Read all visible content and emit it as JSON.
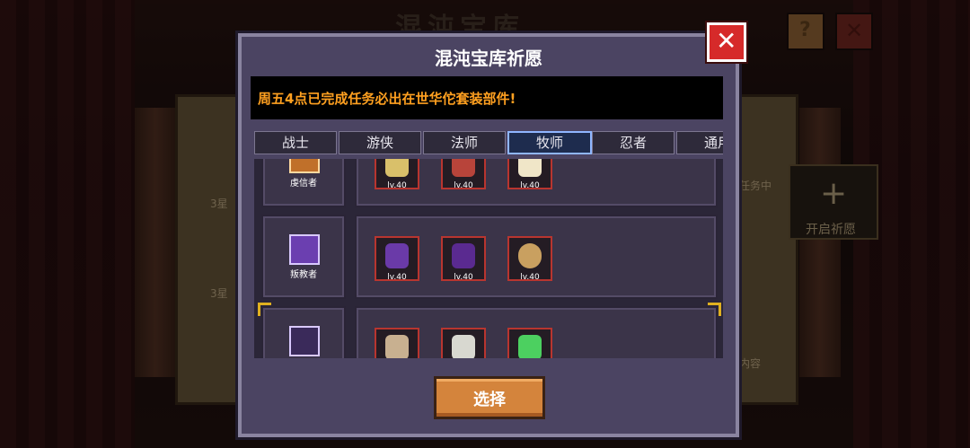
{
  "background": {
    "title": "混沌宝库",
    "left_labels": [
      "3星",
      "3星"
    ],
    "right_labels": [
      "任务中",
      "内容"
    ],
    "open_wish_label": "开启祈愿",
    "help_label": "?",
    "close_label": "✕"
  },
  "dialog": {
    "title": "混沌宝库祈愿",
    "close_label": "✕",
    "notice": "周五4点已完成任务必出在世华佗套装部件!",
    "tabs": [
      "战士",
      "游侠",
      "法师",
      "牧师",
      "忍者",
      "通用"
    ],
    "active_tab": "牧师",
    "rows": [
      {
        "class_name": "虔信者",
        "items": [
          "lv.40",
          "lv.40",
          "lv.40"
        ]
      },
      {
        "class_name": "叛教者",
        "items": [
          "lv.40",
          "lv.40",
          "lv.40"
        ]
      },
      {
        "class_name": "",
        "items": [
          "",
          "",
          ""
        ]
      }
    ],
    "select_label": "选择"
  },
  "colors": {
    "notice_text": "#ffa020",
    "close_red": "#d62a2a",
    "select_orange": "#d4843c",
    "active_tab_border": "#8fb6ff"
  }
}
